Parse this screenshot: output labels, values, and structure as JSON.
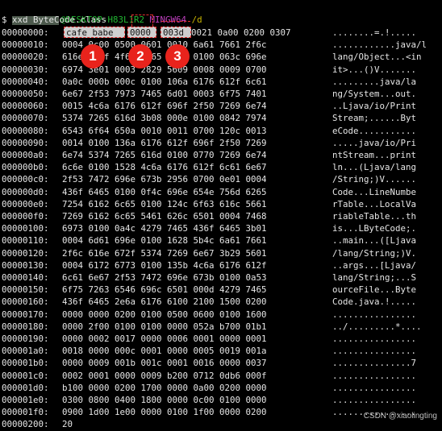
{
  "prompt": {
    "host": "@DESKTOP-H83L1R2",
    "system": "MINGW64",
    "path": "/d"
  },
  "command": "$ xxd ByteCode.class",
  "rows": [
    {
      "offset": "00000000:",
      "hex": "cafe babe 0000 003d 0021 0a00 0200 0307",
      "ascii": "........=.!....."
    },
    {
      "offset": "00000010:",
      "hex": "0004 0c00 0500 0601 0010 6a61 7661 2f6c",
      "ascii": "............java/l"
    },
    {
      "offset": "00000020:",
      "hex": "616e 672f 4f62 6a65 6374 0100 063c 696e",
      "ascii": "lang/Object...<in"
    },
    {
      "offset": "00000030:",
      "hex": "6974 3e01 0003 2829 5609 0008 0009 0700",
      "ascii": "it>...()V......."
    },
    {
      "offset": "00000040:",
      "hex": "0a0c 000b 000c 0100 106a 6176 612f 6c61",
      "ascii": ".........java/la"
    },
    {
      "offset": "00000050:",
      "hex": "6e67 2f53 7973 7465 6d01 0003 6f75 7401",
      "ascii": "ng/System...out."
    },
    {
      "offset": "00000060:",
      "hex": "0015 4c6a 6176 612f 696f 2f50 7269 6e74",
      "ascii": "..Ljava/io/Print"
    },
    {
      "offset": "00000070:",
      "hex": "5374 7265 616d 3b08 000e 0100 0842 7974",
      "ascii": "Stream;......Byt"
    },
    {
      "offset": "00000080:",
      "hex": "6543 6f64 650a 0010 0011 0700 120c 0013",
      "ascii": "eCode..........."
    },
    {
      "offset": "00000090:",
      "hex": "0014 0100 136a 6176 612f 696f 2f50 7269",
      "ascii": ".....java/io/Pri"
    },
    {
      "offset": "000000a0:",
      "hex": "6e74 5374 7265 616d 0100 0770 7269 6e74",
      "ascii": "ntStream...print"
    },
    {
      "offset": "000000b0:",
      "hex": "6c6e 0100 1528 4c6a 6176 612f 6c61 6e67",
      "ascii": "ln...(Ljava/lang"
    },
    {
      "offset": "000000c0:",
      "hex": "2f53 7472 696e 673b 2956 0700 0e01 0004",
      "ascii": "/String;)V......"
    },
    {
      "offset": "000000d0:",
      "hex": "436f 6465 0100 0f4c 696e 654e 756d 6265",
      "ascii": "Code...LineNumbe"
    },
    {
      "offset": "000000e0:",
      "hex": "7254 6162 6c65 0100 124c 6f63 616c 5661",
      "ascii": "rTable...LocalVa"
    },
    {
      "offset": "000000f0:",
      "hex": "7269 6162 6c65 5461 626c 6501 0004 7468",
      "ascii": "riableTable...th"
    },
    {
      "offset": "00000100:",
      "hex": "6973 0100 0a4c 4279 7465 436f 6465 3b01",
      "ascii": "is...LByteCode;."
    },
    {
      "offset": "00000110:",
      "hex": "0004 6d61 696e 0100 1628 5b4c 6a61 7661",
      "ascii": "..main...([Ljava"
    },
    {
      "offset": "00000120:",
      "hex": "2f6c 616e 672f 5374 7269 6e67 3b29 5601",
      "ascii": "/lang/String;)V."
    },
    {
      "offset": "00000130:",
      "hex": "0004 6172 6773 0100 135b 4c6a 6176 612f",
      "ascii": "..args...[Ljava/"
    },
    {
      "offset": "00000140:",
      "hex": "6c61 6e67 2f53 7472 696e 673b 0100 0a53",
      "ascii": "lang/String;...S"
    },
    {
      "offset": "00000150:",
      "hex": "6f75 7263 6546 696c 6501 000d 4279 7465",
      "ascii": "ourceFile...Byte"
    },
    {
      "offset": "00000160:",
      "hex": "436f 6465 2e6a 6176 6100 2100 1500 0200",
      "ascii": "Code.java.!....."
    },
    {
      "offset": "00000170:",
      "hex": "0000 0000 0200 0100 0500 0600 0100 1600",
      "ascii": "................"
    },
    {
      "offset": "00000180:",
      "hex": "0000 2f00 0100 0100 0000 052a b700 01b1",
      "ascii": "../.........*...."
    },
    {
      "offset": "00000190:",
      "hex": "0000 0002 0017 0000 0006 0001 0000 0001",
      "ascii": "................"
    },
    {
      "offset": "000001a0:",
      "hex": "0018 0000 000c 0001 0000 0005 0019 001a",
      "ascii": "................"
    },
    {
      "offset": "000001b0:",
      "hex": "0000 0009 001b 001c 0001 0016 0000 0037",
      "ascii": "...............7"
    },
    {
      "offset": "000001c0:",
      "hex": "0002 0001 0000 0009 b200 0712 0db6 000f",
      "ascii": "................"
    },
    {
      "offset": "000001d0:",
      "hex": "b100 0000 0200 1700 0000 0a00 0200 0000",
      "ascii": "................"
    },
    {
      "offset": "000001e0:",
      "hex": "0300 0800 0400 1800 0000 0c00 0100 0000",
      "ascii": "................"
    },
    {
      "offset": "000001f0:",
      "hex": "0900 1d00 1e00 0000 0100 1f00 0000 0200",
      "ascii": "................"
    },
    {
      "offset": "00000200:",
      "hex": "20",
      "ascii": ""
    }
  ],
  "highlights": {
    "magic": "cafe babe",
    "minor": "0000",
    "major": "003d"
  },
  "badges": [
    "1",
    "2",
    "3"
  ],
  "watermark": "CSDN @xiaolingting",
  "colors": {
    "background": "#000000",
    "text": "#e6e6e6",
    "host": "#21b833",
    "system": "#c040c0",
    "path": "#c8b400",
    "badge": "#e8231c",
    "highlight_border": "#e03030"
  }
}
